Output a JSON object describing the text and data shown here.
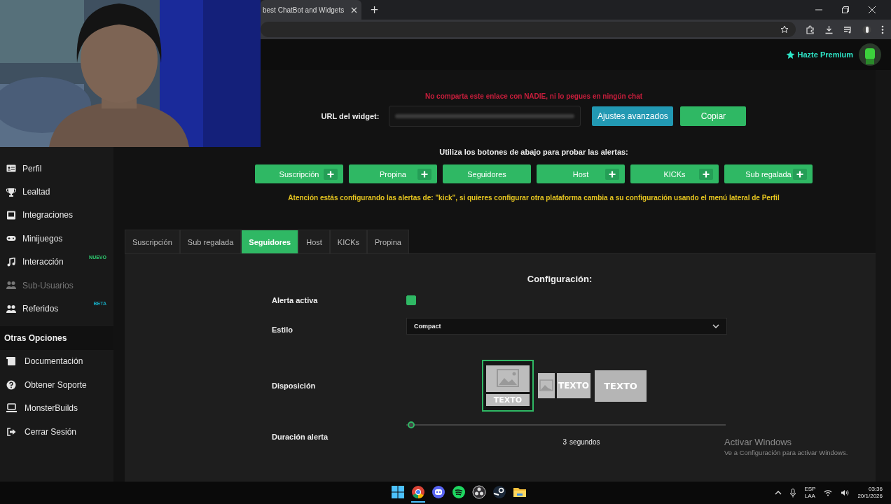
{
  "browser": {
    "tab_title": "best ChatBot and Widgets",
    "new_tab": "+"
  },
  "header": {
    "premium": "Hazte Premium"
  },
  "sidebar": {
    "items": [
      {
        "label": "Perfil",
        "disabled": false
      },
      {
        "label": "Lealtad",
        "disabled": false
      },
      {
        "label": "Integraciones",
        "disabled": false
      },
      {
        "label": "Minijuegos",
        "disabled": false
      },
      {
        "label": "Interacción",
        "disabled": false,
        "badge": {
          "text": "NUEVO",
          "color": "#2ecc71"
        }
      },
      {
        "label": "Sub-Usuarios",
        "disabled": true
      },
      {
        "label": "Referidos",
        "disabled": false,
        "badge": {
          "text": "BETA",
          "color": "#17a2b8"
        }
      }
    ],
    "section": "Otras Opciones",
    "options": [
      {
        "label": "Documentación"
      },
      {
        "label": "Obtener Soporte"
      },
      {
        "label": "MonsterBuilds"
      },
      {
        "label": "Cerrar Sesión"
      }
    ]
  },
  "widget": {
    "warning": "No comparta este enlace con NADIE, ni lo pegues en ningún chat",
    "url_label": "URL del widget:",
    "advanced_button": "Ajustes avanzados",
    "copy_button": "Copiar"
  },
  "test": {
    "prompt": "Utiliza los botones de abajo para probar las alertas:",
    "buttons": [
      {
        "label": "Suscripción",
        "plus": true
      },
      {
        "label": "Propina",
        "plus": true
      },
      {
        "label": "Seguidores",
        "plus": false
      },
      {
        "label": "Host",
        "plus": true
      },
      {
        "label": "KICKs",
        "plus": true
      },
      {
        "label": "Sub regalada",
        "plus": true
      }
    ],
    "notice": "Atención estás configurando las alertas de: \"kick\", si quieres configurar otra plataforma cambia a su configuración usando el menú lateral de Perfil"
  },
  "tabs": [
    {
      "label": "Suscripción",
      "selected": false
    },
    {
      "label": "Sub regalada",
      "selected": false
    },
    {
      "label": "Seguidores",
      "selected": true
    },
    {
      "label": "Host",
      "selected": false
    },
    {
      "label": "KICKs",
      "selected": false
    },
    {
      "label": "Propina",
      "selected": false
    }
  ],
  "config": {
    "title": "Configuración:",
    "alert_active": {
      "label": "Alerta activa",
      "checked": true
    },
    "style": {
      "label": "Estilo",
      "value": "Compact"
    },
    "layout": {
      "label": "Disposición",
      "options": [
        {
          "kind": "stacked",
          "text": "TEXTO",
          "selected": true
        },
        {
          "kind": "side",
          "text": "TEXTO",
          "selected": false
        },
        {
          "kind": "overlay",
          "text": "TEXTO",
          "selected": false
        }
      ]
    },
    "duration": {
      "label": "Duración alerta",
      "level": 0,
      "value": "3",
      "unit": "segundos"
    }
  },
  "watermark": {
    "title": "Activar Windows",
    "text": "Ve a Configuración para activar Windows."
  },
  "taskbar": {
    "apps": [
      {
        "kind": "start",
        "active": false
      },
      {
        "kind": "chrome",
        "active": true
      },
      {
        "kind": "discord",
        "active": false
      },
      {
        "kind": "spotify",
        "active": false
      },
      {
        "kind": "obs",
        "active": false
      },
      {
        "kind": "steam",
        "active": false
      },
      {
        "kind": "folder",
        "active": false
      }
    ],
    "lang": "ESP",
    "region": "LAA",
    "time": "03:36",
    "date": "20/1/2026"
  }
}
